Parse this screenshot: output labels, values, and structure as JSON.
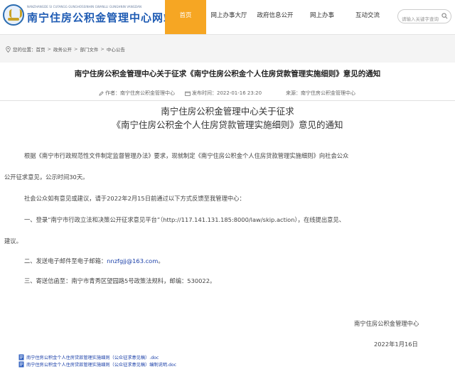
{
  "header": {
    "logo_pinyin": "NANZHANGDE SI CUFANGG GUNGHOSSINHIN GWANLLI GUNGHNIN VANGDAN",
    "logo_title": "南宁住房公积金管理中心网站",
    "nav": [
      {
        "label": "首页",
        "active": true
      },
      {
        "label": "网上办事大厅",
        "active": false
      },
      {
        "label": "政府信息公开",
        "active": false
      },
      {
        "label": "网上办事",
        "active": false
      },
      {
        "label": "互动交流",
        "active": false
      }
    ],
    "search_placeholder": "请输入关键字查询"
  },
  "breadcrumb": {
    "prefix": "您的位置：",
    "items": [
      "首页",
      "政务公开",
      "部门文件",
      "中心公告"
    ],
    "separator": ">"
  },
  "article": {
    "title": "南宁住房公积金管理中心关于征求《南宁住房公积金个人住房贷款管理实施细则》意见的通知",
    "author": "作者：南宁住房公积金管理中心",
    "publish_time": "发布时间：2022-01-16 23:20",
    "source": "来源：南宁住房公积金管理中心",
    "doc_title_line1": "南宁住房公积金管理中心关于征求",
    "doc_title_line2": "《南宁住房公积金个人住房贷款管理实施细则》意见的通知",
    "para1_line1": "根据《南宁市行政规范性文件制定监督管理办法》要求，现就制定《南宁住房公积金个人住房贷款管理实施细则》向社会公众",
    "para1_line2": "公开征求意见，公示时间30天。",
    "para2": "社会公众如有意见或建议，请于2022年2月15日前通过以下方式反馈至我管理中心：",
    "para3_line1": "一、登录“南宁市行政立法和决策公开征求意见平台”（http://117.141.131.185:8000/law/skip.action），在线提出意见、",
    "para3_line2": "建议。",
    "para4_prefix": "二、发送电子邮件至电子邮箱：",
    "para4_email": "nnzfgjj@163.com",
    "para4_suffix": "。",
    "para5": "三、寄送信函至：南宁市青秀区望园路5号政策法规科，邮编：530022。",
    "sign_org": "南宁住房公积金管理中心",
    "sign_date": "2022年1月16日",
    "attachments": [
      "南宁住房公积金个人住房贷款管理实施细则（公众征求意见稿）.doc",
      "南宁住房公积金个人住房贷款管理实施细则（公众征求意见稿）编制说明.doc"
    ]
  },
  "colors": {
    "nav_active": "#f6a623",
    "logo_blue": "#1e5bb3",
    "link_blue": "#1a3fa8"
  }
}
